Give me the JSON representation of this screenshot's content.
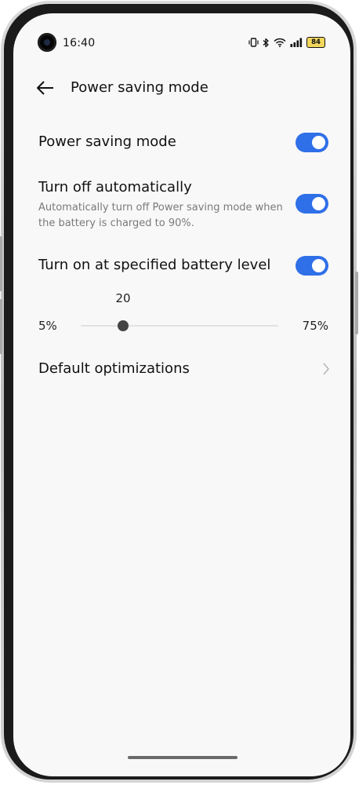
{
  "status_bar": {
    "time": "16:40",
    "battery_level": "84",
    "icons": [
      "vibrate-icon",
      "bluetooth-icon",
      "wifi-icon",
      "cellular-signal-icon",
      "battery-icon"
    ]
  },
  "header": {
    "title": "Power saving mode",
    "back_icon": "back-arrow-icon"
  },
  "settings": {
    "power_saving": {
      "label": "Power saving mode",
      "enabled": true
    },
    "turn_off_auto": {
      "label": "Turn off automatically",
      "description": "Automatically turn off Power saving mode when the battery is charged to 90%.",
      "enabled": true
    },
    "turn_on_level": {
      "label": "Turn on at specified battery level",
      "enabled": true
    },
    "battery_slider": {
      "value": "20",
      "min_label": "5%",
      "max_label": "75%",
      "min": 5,
      "max": 75,
      "current": 20
    },
    "default_optimizations": {
      "label": "Default optimizations",
      "icon": "chevron-right-icon"
    }
  },
  "colors": {
    "accent": "#2f6fe8",
    "background": "#f8f8f8",
    "battery_fill": "#f3d75c",
    "slider_thumb": "#444444"
  }
}
